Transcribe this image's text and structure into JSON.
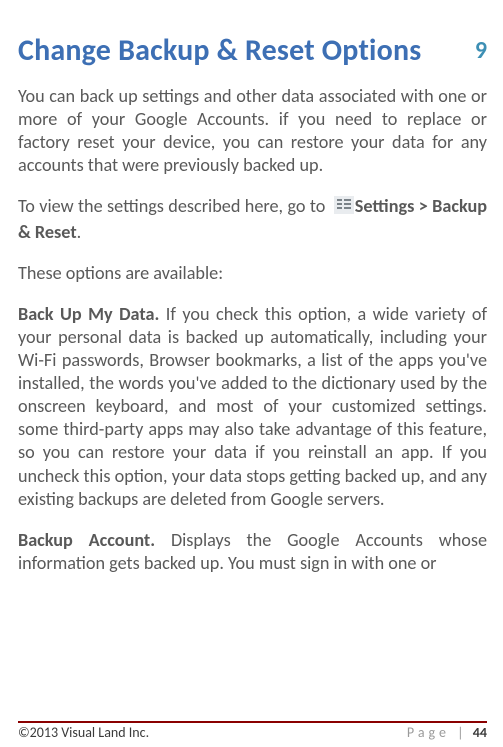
{
  "chapter_number": "9",
  "title": "Change Backup & Reset Options",
  "para1": "You can back up settings and other data associated with one or more of your Google Accounts. if you need to replace or factory reset your device, you can restore your data for any accounts that were previously backed up.",
  "para2_a": "To view the settings described here, go to ",
  "para2_b": "Settings > Backup & Reset",
  "para2_c": ".",
  "para3": "These options are available:",
  "item1_label": "Back Up My Data.",
  "item1_body": " If you check this option, a wide variety of your personal data is backed up automatically, including your Wi-Fi passwords, Browser bookmarks, a list of the apps you've installed, the words you've added to the dictionary used by the onscreen keyboard, and most of your customized settings. some third-party apps may also take advantage of this feature, so you can restore your data if you reinstall an app. If you uncheck this option, your data stops getting backed up, and any existing backups are deleted from Google servers.",
  "item2_label": "Backup Account.",
  "item2_body": " Displays the Google Accounts whose information gets backed up. You must sign in with one or",
  "footer": {
    "left": "©2013 Visual Land Inc.",
    "page_word": "Page",
    "sep": "|",
    "num": "44"
  }
}
